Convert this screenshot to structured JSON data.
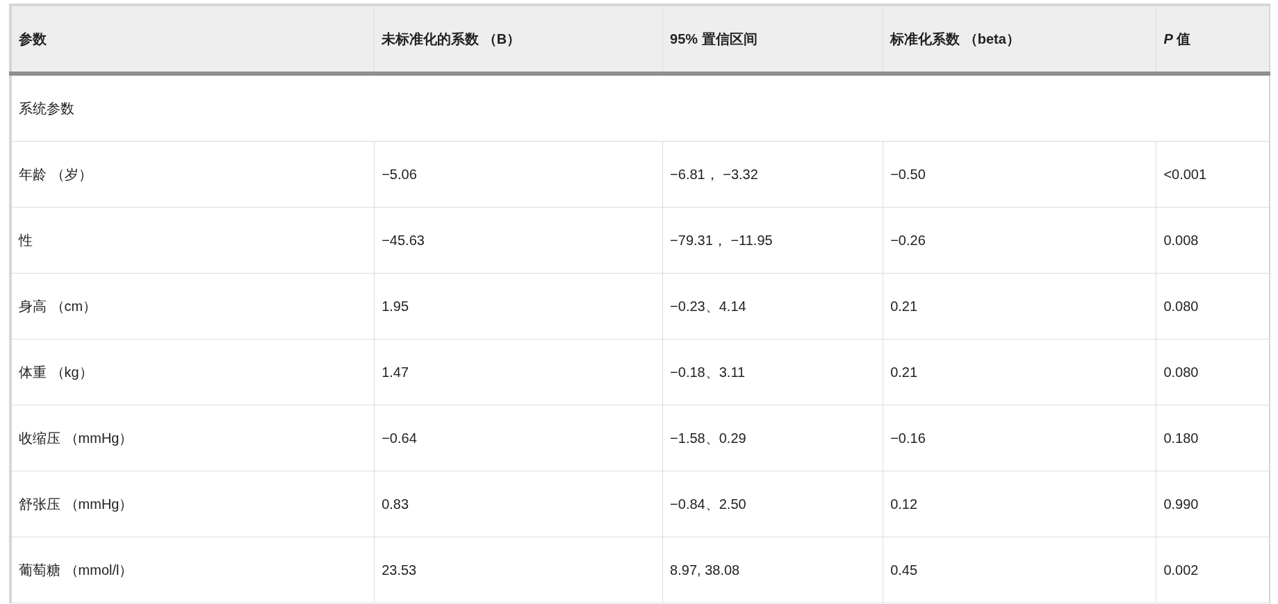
{
  "table": {
    "columns": [
      "参数",
      "未标准化的系数 （B）",
      "95% 置信区间",
      "标准化系数 （beta）",
      "*P* 值"
    ],
    "sections": [
      {
        "title": "系统参数",
        "rows": [
          [
            "年龄 （岁）",
            "−5.06",
            "−6.81，  −3.32",
            "−0.50",
            "<0.001"
          ],
          [
            "性",
            "−45.63",
            "−79.31，  −11.95",
            "−0.26",
            "0.008"
          ],
          [
            "身高 （cm）",
            "1.95",
            "−0.23、4.14",
            "0.21",
            "0.080"
          ],
          [
            "体重 （kg）",
            "1.47",
            "−0.18、3.11",
            "0.21",
            "0.080"
          ],
          [
            "收缩压 （mmHg）",
            "−0.64",
            "−1.58、0.29",
            "−0.16",
            "0.180"
          ],
          [
            "舒张压 （mmHg）",
            "0.83",
            "−0.84、2.50",
            "0.12",
            "0.990"
          ],
          [
            "葡萄糖 （mmol/l）",
            "23.53",
            "8.97, 38.08",
            "0.45",
            "0.002"
          ]
        ]
      }
    ]
  }
}
